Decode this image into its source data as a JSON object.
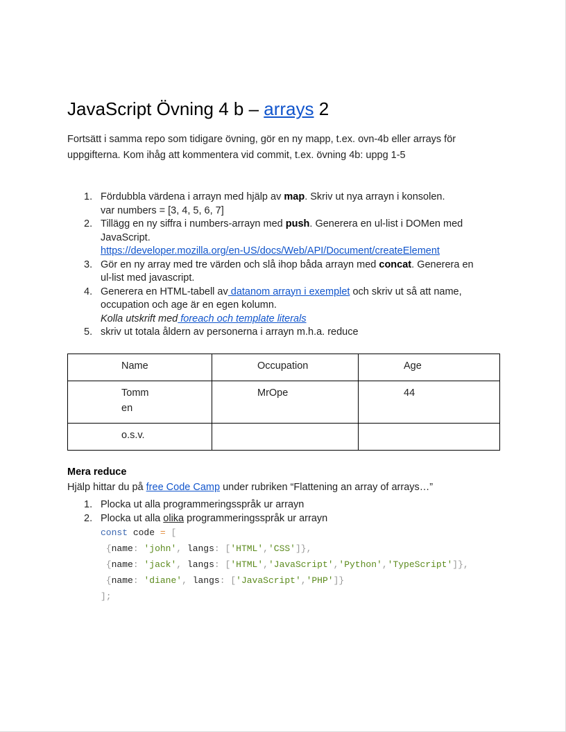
{
  "title": {
    "before": "JavaScript Övning 4 b – ",
    "link": "arrays",
    "after": " 2"
  },
  "intro": {
    "line1": "Fortsätt i samma repo som tidigare övning, gör en ny mapp, t.ex. ovn-4b eller arrays för",
    "line2": "uppgifterna. Kom ihåg att kommentera vid commit, t.ex. övning 4b: uppg 1-5"
  },
  "tasks": [
    {
      "num": "1.",
      "t1": " Fördubbla värdena i arrayn med hjälp av ",
      "bold": "map",
      "t2": ". Skriv ut nya arrayn i konsolen.",
      "line2": "var numbers = [3, 4, 5, 6, 7]"
    },
    {
      "num": "2.",
      "t1": "Tillägg en ny siffra i numbers-arrayn med ",
      "bold": "push",
      "t2": ". Generera en ul-list i DOMen med",
      "line2": "JavaScript.",
      "link": "https://developer.mozilla.org/en-US/docs/Web/API/Document/createElement"
    },
    {
      "num": "3.",
      "t1": " Gör en ny array med tre värden och slå ihop båda arrayn med ",
      "bold": "concat",
      "t2": ". Generera en",
      "line2": "ul-list med javascript."
    },
    {
      "num": "4.",
      "t1": "Generera en HTML-tabell av",
      "link1": " datanom arrayn i exemplet",
      "t2": " och skriv ut så att name,",
      "line2": "occupation och age är en egen kolumn.",
      "italic": "Kolla utskrift med",
      "link2": " foreach och template literals"
    },
    {
      "num": "5.",
      "t1": "skriv ut totala åldern av personerna i arrayn m.h.a. reduce"
    }
  ],
  "table": {
    "headers": [
      "Name",
      "Occupation",
      "Age"
    ],
    "rows": [
      [
        "Tommen",
        "MrOpe",
        "44"
      ],
      [
        "o.s.v.",
        "",
        ""
      ]
    ]
  },
  "more": {
    "title": "Mera reduce",
    "intro_before": "Hjälp hittar du på ",
    "intro_link": "free Code Camp",
    "intro_after": " under rubriken “Flattening an array of arrays…”",
    "items": [
      {
        "num": "1.",
        "text": "Plocka ut alla programmeringsspråk ur arrayn"
      },
      {
        "num": "2.",
        "before": "Plocka ut alla ",
        "underlined": "olika",
        "after": " programmeringsspråk ur arrayn"
      }
    ]
  },
  "code": {
    "kw": "const",
    "var": " code ",
    "eq": "=",
    "open": " [",
    "rows": [
      {
        "name": "'john'",
        "langs": [
          "'HTML'",
          "'CSS'"
        ],
        "end": "]},"
      },
      {
        "name": "'jack'",
        "langs": [
          "'HTML'",
          "'JavaScript'",
          "'Python'",
          "'TypeScript'"
        ],
        "end": "]},"
      },
      {
        "name": "'diane'",
        "langs": [
          "'JavaScript'",
          "'PHP'"
        ],
        "end": "]}"
      }
    ],
    "close": "];"
  }
}
